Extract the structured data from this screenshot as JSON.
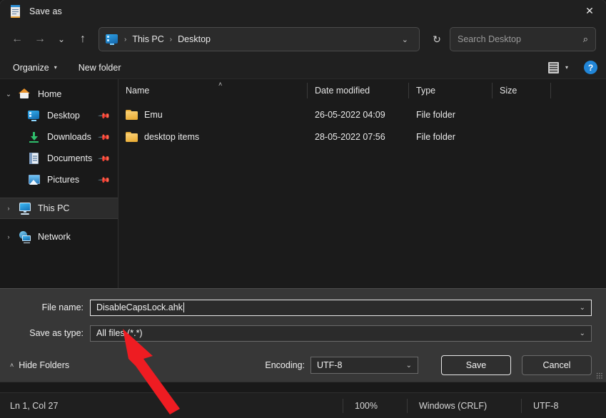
{
  "window": {
    "title": "Save as",
    "title_icon": "notepad-icon",
    "close_label": "✕"
  },
  "nav": {
    "back_icon": "←",
    "forward_icon": "→",
    "recent_icon": "⌄",
    "up_icon": "↑",
    "refresh_icon": "↻",
    "address_dropdown_icon": "⌄",
    "breadcrumbs": [
      "This PC",
      "Desktop"
    ],
    "breadcrumb_separator": "›",
    "search_placeholder": "Search Desktop",
    "search_icon": "⌕"
  },
  "toolbar": {
    "organize_label": "Organize",
    "organize_caret": "▾",
    "new_folder_label": "New folder",
    "view_caret": "▾",
    "help_label": "?"
  },
  "sidebar": {
    "items": [
      {
        "label": "Home",
        "icon": "home-icon",
        "expander": "⌄",
        "expanded": true,
        "pinned": false,
        "indented": false,
        "selected": false
      },
      {
        "label": "Desktop",
        "icon": "desktop-icon",
        "expander": "",
        "pinned": true,
        "indented": true,
        "selected": false
      },
      {
        "label": "Downloads",
        "icon": "downloads-icon",
        "expander": "",
        "pinned": true,
        "indented": true,
        "selected": false
      },
      {
        "label": "Documents",
        "icon": "documents-icon",
        "expander": "",
        "pinned": true,
        "indented": true,
        "selected": false
      },
      {
        "label": "Pictures",
        "icon": "pictures-icon",
        "expander": "",
        "pinned": true,
        "indented": true,
        "selected": false
      },
      {
        "label": "This PC",
        "icon": "this-pc-icon",
        "expander": "›",
        "pinned": false,
        "indented": false,
        "selected": true
      },
      {
        "label": "Network",
        "icon": "network-icon",
        "expander": "›",
        "pinned": false,
        "indented": false,
        "selected": false
      }
    ],
    "pin_icon": "📌"
  },
  "filelist": {
    "columns": [
      "Name",
      "Date modified",
      "Type",
      "Size"
    ],
    "sort_caret": "˄",
    "sort_column": "Name",
    "rows": [
      {
        "name": "Emu",
        "date": "26-05-2022 04:09",
        "type": "File folder",
        "size": ""
      },
      {
        "name": "desktop items",
        "date": "28-05-2022 07:56",
        "type": "File folder",
        "size": ""
      }
    ]
  },
  "form": {
    "file_name_label": "File name:",
    "file_name_value": "DisableCapsLock.ahk",
    "save_as_type_label": "Save as type:",
    "save_as_type_value": "All files  (*.*)",
    "dropdown_icon": "⌄",
    "hide_folders_label": "Hide Folders",
    "hide_folders_caret": "˄",
    "encoding_label": "Encoding:",
    "encoding_value": "UTF-8",
    "save_label": "Save",
    "cancel_label": "Cancel"
  },
  "statusbar": {
    "position": "Ln 1, Col 27",
    "zoom": "100%",
    "line_ending": "Windows (CRLF)",
    "encoding": "UTF-8"
  },
  "annotation": {
    "arrow_color": "#ee1c22"
  }
}
